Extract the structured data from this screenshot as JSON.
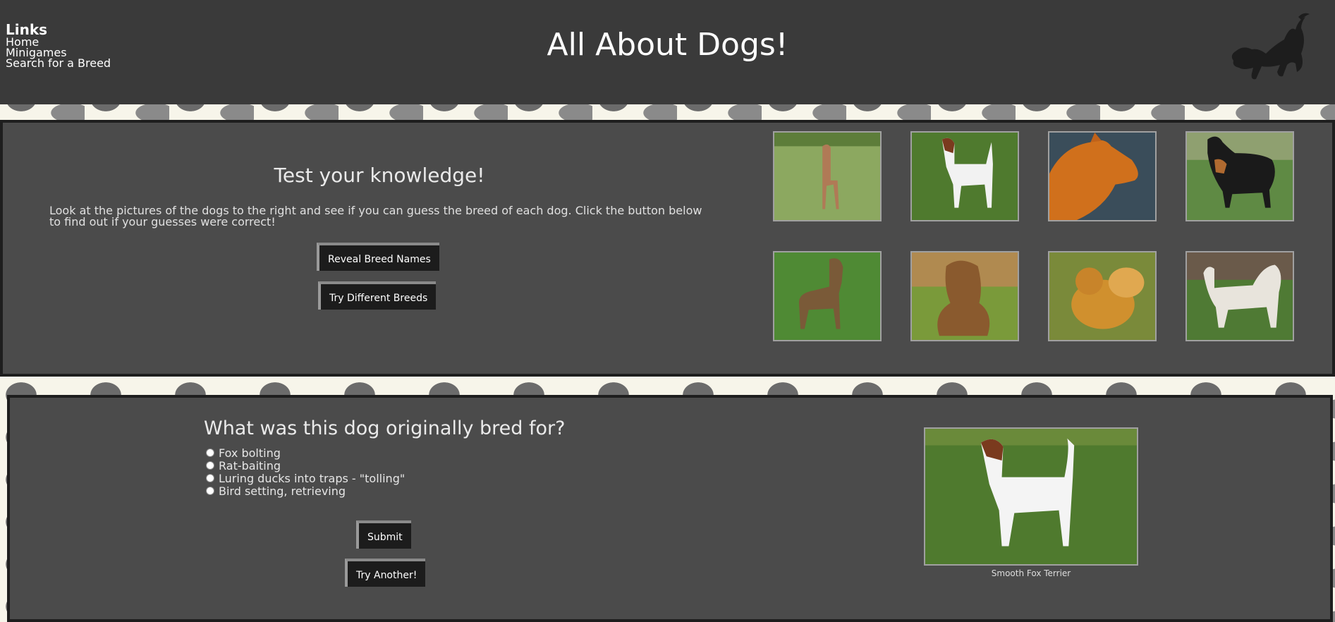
{
  "header": {
    "title": "All About Dogs!",
    "links_heading": "Links",
    "links": [
      "Home",
      "Minigames",
      "Search for a Breed"
    ],
    "logo_icon": "dog-silhouette-icon"
  },
  "quiz": {
    "heading": "Test your knowledge!",
    "instructions": "Look at the pictures of the dogs to the right and see if you can guess the breed of each dog. Click the button below to find out if your guesses were correct!",
    "reveal_button": "Reveal Breed Names",
    "try_different_button": "Try Different Breeds"
  },
  "question": {
    "heading": "What was this dog originally bred for?",
    "options": [
      "Fox bolting",
      "Rat-baiting",
      "Luring ducks into traps - \"tolling\"",
      "Bird setting, retrieving"
    ],
    "submit_button": "Submit",
    "try_another_button": "Try Another!",
    "image_caption": "Smooth Fox Terrier"
  },
  "colors": {
    "header_bg": "#3a3a3a",
    "panel_bg": "#4b4b4b",
    "button_bg": "#1c1c1c"
  }
}
